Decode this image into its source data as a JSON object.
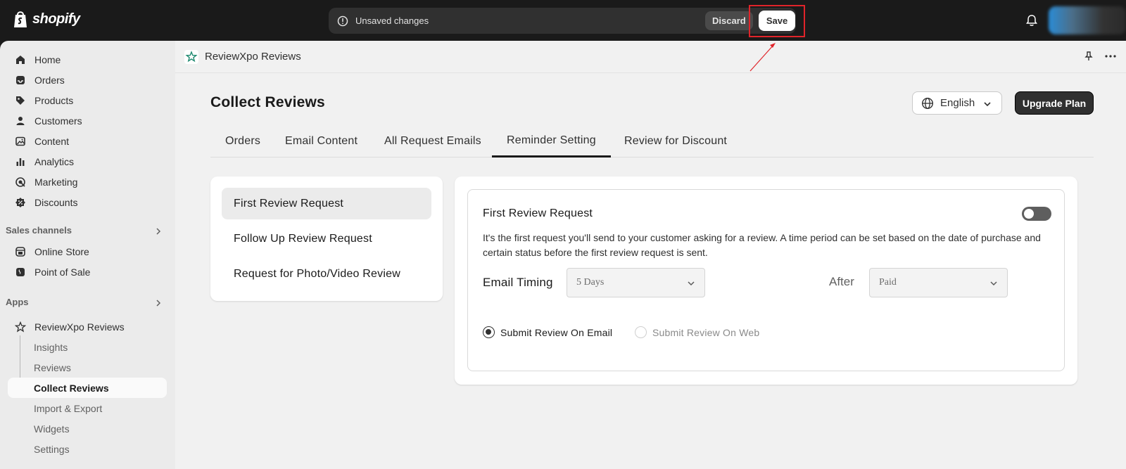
{
  "topbar": {
    "logo_text": "shopify",
    "unsaved_text": "Unsaved changes",
    "discard_label": "Discard",
    "save_label": "Save"
  },
  "sidebar": {
    "items": [
      {
        "label": "Home",
        "icon": "home-icon"
      },
      {
        "label": "Orders",
        "icon": "inbox-icon"
      },
      {
        "label": "Products",
        "icon": "tag-icon"
      },
      {
        "label": "Customers",
        "icon": "person-icon"
      },
      {
        "label": "Content",
        "icon": "image-icon"
      },
      {
        "label": "Analytics",
        "icon": "bar-chart-icon"
      },
      {
        "label": "Marketing",
        "icon": "target-icon"
      },
      {
        "label": "Discounts",
        "icon": "discount-icon"
      }
    ],
    "sales_channels_label": "Sales channels",
    "sales_channels": [
      {
        "label": "Online Store",
        "icon": "store-icon"
      },
      {
        "label": "Point of Sale",
        "icon": "pos-icon"
      }
    ],
    "apps_label": "Apps",
    "app_name": "ReviewXpo Reviews",
    "app_subitems": [
      "Insights",
      "Reviews",
      "Collect Reviews",
      "Import & Export",
      "Widgets",
      "Settings"
    ]
  },
  "app_header": {
    "title": "ReviewXpo Reviews"
  },
  "page": {
    "title": "Collect Reviews",
    "language": "English",
    "upgrade_label": "Upgrade Plan",
    "tabs": [
      "Orders",
      "Email Content",
      "All Request Emails",
      "Reminder Setting",
      "Review for Discount"
    ],
    "active_tab": "Reminder Setting"
  },
  "requests": [
    "First Review Request",
    "Follow Up Review Request",
    "Request for Photo/Video Review"
  ],
  "detail": {
    "title": "First Review Request",
    "toggle_on": false,
    "description": "It's the first request you'll send to your customer asking for a review. A time period can be set based on the date of purchase and certain status before the first review request is sent.",
    "timing_label": "Email Timing",
    "timing_value": "5 Days",
    "after_label": "After",
    "after_value": "Paid",
    "radio_email": "Submit Review On Email",
    "radio_web": "Submit Review On Web"
  },
  "colors": {
    "topbar_bg": "#1a1a1a",
    "highlight_red": "#e0242a",
    "sidebar_bg": "#ebebeb",
    "main_bg": "#f1f1f1"
  }
}
